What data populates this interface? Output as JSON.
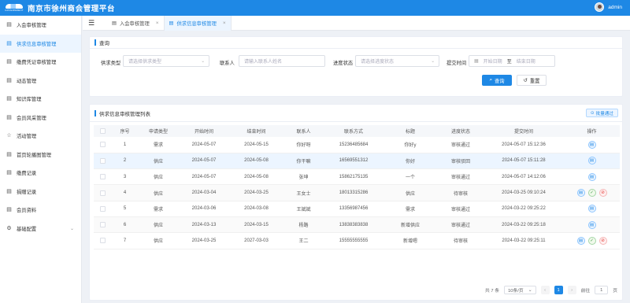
{
  "app": {
    "logo_text": "GOVERNMENT",
    "title": "南京市徐州商会管理平台",
    "user": "admin"
  },
  "sidebar": {
    "items": [
      {
        "label": "入会审核管理",
        "icon": "document-icon"
      },
      {
        "label": "供求信息审核管理",
        "icon": "document-icon"
      },
      {
        "label": "缴费凭证审核管理",
        "icon": "document-icon"
      },
      {
        "label": "动态管理",
        "icon": "document-icon"
      },
      {
        "label": "知识库管理",
        "icon": "document-icon"
      },
      {
        "label": "会员风采管理",
        "icon": "document-icon"
      },
      {
        "label": "活动管理",
        "icon": "star-icon"
      },
      {
        "label": "首页轮播图管理",
        "icon": "document-icon"
      },
      {
        "label": "缴费记录",
        "icon": "document-icon"
      },
      {
        "label": "捐赠记录",
        "icon": "document-icon"
      },
      {
        "label": "会员资料",
        "icon": "document-icon"
      },
      {
        "label": "基础配置",
        "icon": "gear-icon"
      }
    ]
  },
  "tabs": [
    {
      "label": "入会审核管理",
      "close": "×"
    },
    {
      "label": "供求信息审核管理",
      "close": "×"
    }
  ],
  "query": {
    "title": "查询",
    "type_label": "供求类型",
    "type_placeholder": "请选择供求类型",
    "contact_label": "联系人",
    "contact_placeholder": "请输入联系人姓名",
    "status_label": "进度状态",
    "status_placeholder": "请选择进度状态",
    "time_label": "提交时间",
    "start_placeholder": "开始日期",
    "range_sep": "至",
    "end_placeholder": "结束日期",
    "search_btn": "查询",
    "reset_btn": "重置"
  },
  "list": {
    "title": "供求信息审核管理列表",
    "batch_btn": "批量通过",
    "columns": [
      "序号",
      "申请类型",
      "开始时间",
      "结束时间",
      "联系人",
      "联系方式",
      "标题",
      "进度状态",
      "提交时间",
      "操作"
    ],
    "rows": [
      {
        "no": "1",
        "type": "需求",
        "start": "2024-05-07",
        "end": "2024-05-15",
        "contact": "你好呀",
        "phone": "15236485684",
        "title": "你好y",
        "status": "审核通过",
        "submitted": "2024-05-07 15:12:36",
        "pending": false
      },
      {
        "no": "2",
        "type": "供应",
        "start": "2024-05-07",
        "end": "2024-05-08",
        "contact": "你干嘛",
        "phone": "16569551312",
        "title": "你好",
        "status": "审核驳回",
        "submitted": "2024-05-07 15:11:28",
        "pending": false
      },
      {
        "no": "3",
        "type": "供应",
        "start": "2024-05-07",
        "end": "2024-05-08",
        "contact": "张坤",
        "phone": "15862175135",
        "title": "一个",
        "status": "审核通过",
        "submitted": "2024-05-07 14:12:06",
        "pending": false
      },
      {
        "no": "4",
        "type": "供应",
        "start": "2024-03-04",
        "end": "2024-03-25",
        "contact": "王女士",
        "phone": "18013315286",
        "title": "供应",
        "status": "待审核",
        "submitted": "2024-03-25 09:10:24",
        "pending": true
      },
      {
        "no": "5",
        "type": "需求",
        "start": "2024-03-06",
        "end": "2024-03-08",
        "contact": "王斌斌",
        "phone": "13356987456",
        "title": "需求",
        "status": "审核通过",
        "submitted": "2024-03-22 09:25:22",
        "pending": false
      },
      {
        "no": "6",
        "type": "供应",
        "start": "2024-03-13",
        "end": "2024-03-15",
        "contact": "杨路",
        "phone": "13838383838",
        "title": "新增供应",
        "status": "审核通过",
        "submitted": "2024-03-22 09:25:18",
        "pending": false
      },
      {
        "no": "7",
        "type": "供应",
        "start": "2024-03-25",
        "end": "2027-03-03",
        "contact": "王二",
        "phone": "15555555555",
        "title": "新增嗯",
        "status": "待审核",
        "submitted": "2024-03-22 09:25:11",
        "pending": true
      }
    ]
  },
  "pager": {
    "total": "共 7 条",
    "page_size": "10条/页",
    "current": "1",
    "goto_label": "前往",
    "goto_value": "1",
    "page_unit": "页",
    "prev": "‹",
    "next": "›"
  }
}
